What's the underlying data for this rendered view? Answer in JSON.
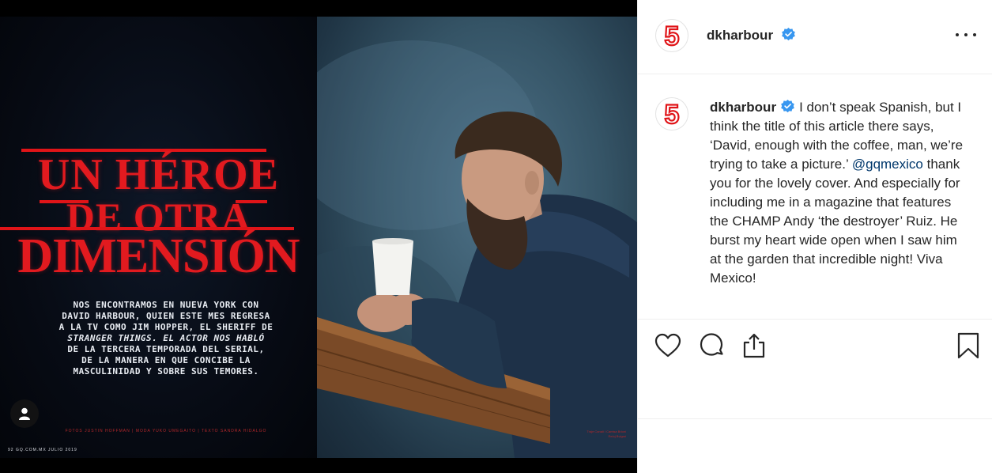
{
  "media": {
    "headline": {
      "line1": "Un Héroe",
      "line2": "De Otra",
      "line3": "Dimensión"
    },
    "deck": [
      "Nos encontramos en Nueva York con",
      "David Harbour, quien este mes regresa",
      "a la TV como Jim Hopper, el sheriff de",
      "Stranger Things. El actor nos habló",
      "de la tercera temporada del serial,",
      "de la manera en que concibe la",
      "masculinidad y sobre sus temores."
    ],
    "credits": "Fotos Justin Hoffman | Moda Yuko Umegaito | Texto Sandra Hidalgo",
    "folio": "92 GQ.COM.MX JULIO 2019",
    "photo_credit_1": "Traje Canali / Camisa Brioni",
    "photo_credit_2": "Reloj Bvlgari",
    "colors": {
      "headline_red": "#e21a1f",
      "wall_blue": "#355466",
      "table_wood": "#7a4a27"
    }
  },
  "post": {
    "username": "dkharbour",
    "avatar_glyph": "5",
    "caption": {
      "username": "dkharbour",
      "text_1": "I don’t speak Spanish, but I think the title of this article there says, ‘David, enough with the coffee, man, we’re trying to take a picture.’",
      "mention": "@gqmexico",
      "text_2": "thank you for the lovely cover. And especially for including me in a magazine that features the CHAMP Andy ‘the destroyer’ Ruiz. He burst my heart wide open when I saw him at the garden that incredible night! Viva Mexico!"
    },
    "icons": {
      "more": "more-options-icon",
      "verified": "verified-badge-icon",
      "like": "heart-icon",
      "comment": "comment-icon",
      "share": "share-icon",
      "save": "bookmark-icon",
      "tag": "user-tag-icon"
    }
  }
}
